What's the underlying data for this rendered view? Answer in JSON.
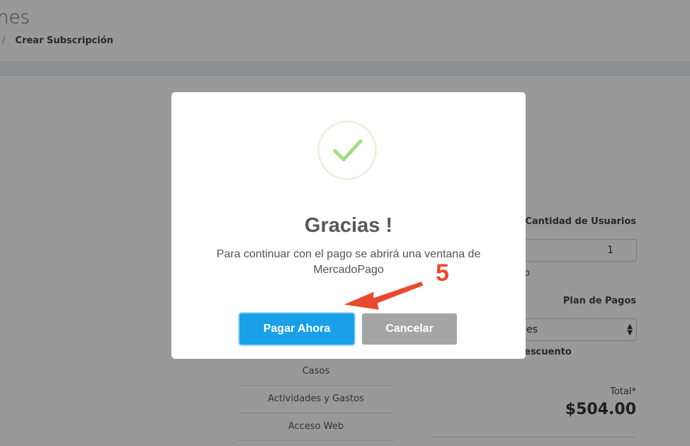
{
  "page": {
    "title": "nes",
    "breadcrumb_sep": "/",
    "breadcrumb_current": "Crear Subscripción"
  },
  "form": {
    "users_label": "Cantidad de Usuarios",
    "users_value": "1",
    "users_helper": "o",
    "plan_label": "Plan de Pagos",
    "plan_value": "es",
    "discount_label": "escuento",
    "total_label": "Total*",
    "total_value": "$504.00"
  },
  "modules": [
    "Casos",
    "Actividades y Gastos",
    "Acceso Web"
  ],
  "modal": {
    "title": "Gracias !",
    "message": "Para continuar con el pago se abrirá una ventana de MercadoPago",
    "confirm_label": "Pagar Ahora",
    "cancel_label": "Cancelar"
  },
  "annotation": {
    "step": "5"
  },
  "colors": {
    "primary_button": "#1aa0e6",
    "cancel_button": "#a5a5a5",
    "success_check": "#a5dc86",
    "annotation_red": "#e84a2f"
  }
}
